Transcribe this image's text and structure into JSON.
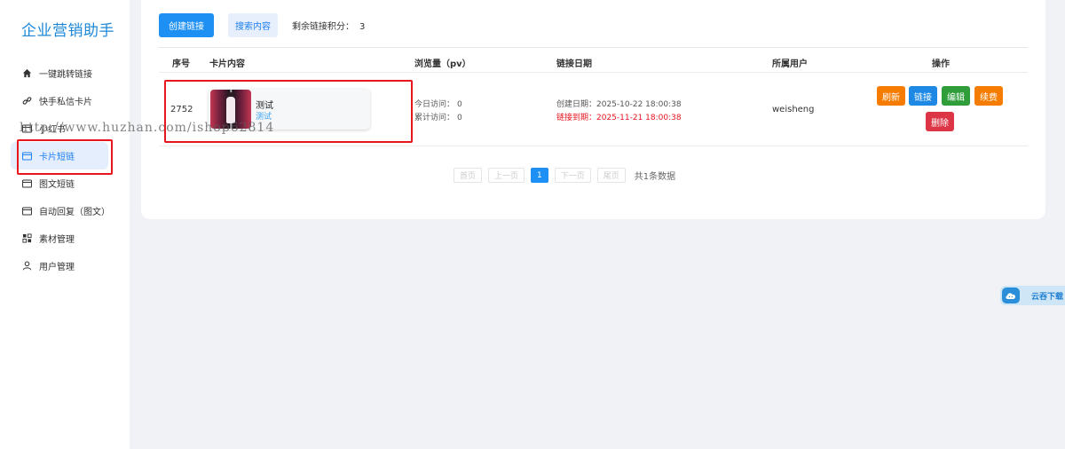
{
  "sidebar": {
    "brand": "企业营销助手",
    "items": [
      {
        "label": "一键跳转链接",
        "icon": "home-icon"
      },
      {
        "label": "快手私信卡片",
        "icon": "link-icon"
      },
      {
        "label": "小红书",
        "icon": "card-icon"
      },
      {
        "label": "卡片短链",
        "icon": "card-icon",
        "active": true
      },
      {
        "label": "图文短链",
        "icon": "card-icon"
      },
      {
        "label": "自动回复（图文）",
        "icon": "card-icon"
      },
      {
        "label": "素材管理",
        "icon": "grid-icon"
      },
      {
        "label": "用户管理",
        "icon": "user-icon"
      }
    ]
  },
  "watermark": "http://www.huzhan.com/ishop62814",
  "toolbar": {
    "create_label": "创建链接",
    "search_label": "搜索内容",
    "credit_label": "剩余链接积分：",
    "credit_value": "3"
  },
  "table": {
    "headers": [
      "序号",
      "卡片内容",
      "浏览量（pv）",
      "链接日期",
      "所属用户",
      "操作"
    ],
    "rows": [
      {
        "id": "2752",
        "content_title": "测试",
        "content_sub": "测试",
        "today_label": "今日访问：",
        "today_value": "0",
        "total_label": "累计访问：",
        "total_value": "0",
        "created": "创建日期：2025-10-22 18:00:38",
        "expires": "链接到期：2025-11-21 18:00:38",
        "user": "weisheng",
        "actions": [
          "刷新",
          "链接",
          "编辑",
          "续费",
          "删除"
        ]
      }
    ]
  },
  "pagination": {
    "first": "首页",
    "prev": "上一页",
    "current": "1",
    "next": "下一页",
    "last": "尾页",
    "total": "共1条数据"
  },
  "widget": {
    "label": "云吞下载"
  },
  "colors": {
    "primary": "#1e90f4",
    "refresh": "#f57c00",
    "link": "#1e88e5",
    "edit": "#2e9d3a",
    "renew": "#f57c00",
    "delete": "#dc3545",
    "highlight": "#e8141e"
  }
}
